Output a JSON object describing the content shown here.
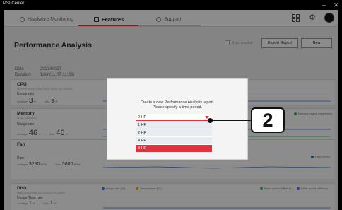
{
  "window": {
    "title": "MSI Center",
    "minimize": "–",
    "close": "✕"
  },
  "nav": {
    "tabs": [
      {
        "label": "Hardware Monitoring",
        "icon": "clock-icon"
      },
      {
        "label": "Features",
        "icon": "features-icon"
      },
      {
        "label": "Support",
        "icon": "support-icon"
      }
    ],
    "active_tab": "Features",
    "right_icons": [
      "grid-icon",
      "gear-icon",
      "avatar"
    ]
  },
  "page": {
    "title": "Performance Analysis",
    "sync_timeline": "Sync timeline",
    "export_button": "Export Report",
    "new_button": "New",
    "date_label": "Date",
    "date_value": "2023/02/27",
    "duration_label": "Duration",
    "duration_value": "1min(11:07-11:08)"
  },
  "sections": {
    "cpu": {
      "title": "CPU",
      "subtitle": "11th Gen Intel(R) Core(TM) i5-11500T @ 1.50GHz",
      "usage_label": "Usage rate",
      "avg_label": "Average",
      "avg_value": "3",
      "max_label": "Max",
      "max_value": "3",
      "unit": "%"
    },
    "memory": {
      "title": "Memory",
      "subtitle": "16GB (DDR4800)",
      "usage_label": "Usage rate",
      "avg_label": "Average",
      "avg_value": "46",
      "max_label": "Max",
      "max_value": "46",
      "unit": "%",
      "legend_right": "Memory pages (pages/sec)"
    },
    "fan": {
      "title": "Fan",
      "sub_label": "Rate",
      "avg_label": "Average",
      "avg_value": "3280",
      "max_label": "Max",
      "max_value": "3600",
      "unit": "RPM",
      "legend_right": "Rate (RPM)"
    },
    "disk": {
      "title": "Disk",
      "subtitle": "Disk0 / SAMSUNG MZVL2512HCJQ-00B00",
      "usage_label": "Usage Time rate",
      "avg_label": "Average",
      "avg_value": "1",
      "max_label": "Max",
      "max_value": "1",
      "unit": "%",
      "legend": [
        "Usage rate (%)",
        "Temperature (°C)",
        "Read speed (KB/sec)",
        "Write speed (KB/sec)"
      ]
    }
  },
  "modal": {
    "message_line1": "Create a new Performance Analysis report.",
    "message_line2": "Please specify a time period.",
    "selected": "2 HR",
    "options": [
      "1 HR",
      "2 HR",
      "4 HR",
      "8 HR"
    ],
    "highlighted_option": "8 HR"
  },
  "callout": {
    "number": "2"
  },
  "colors": {
    "accent": "#e0323d",
    "chart_blue": "#2c7be5",
    "chart_green": "#3cbf6d"
  }
}
